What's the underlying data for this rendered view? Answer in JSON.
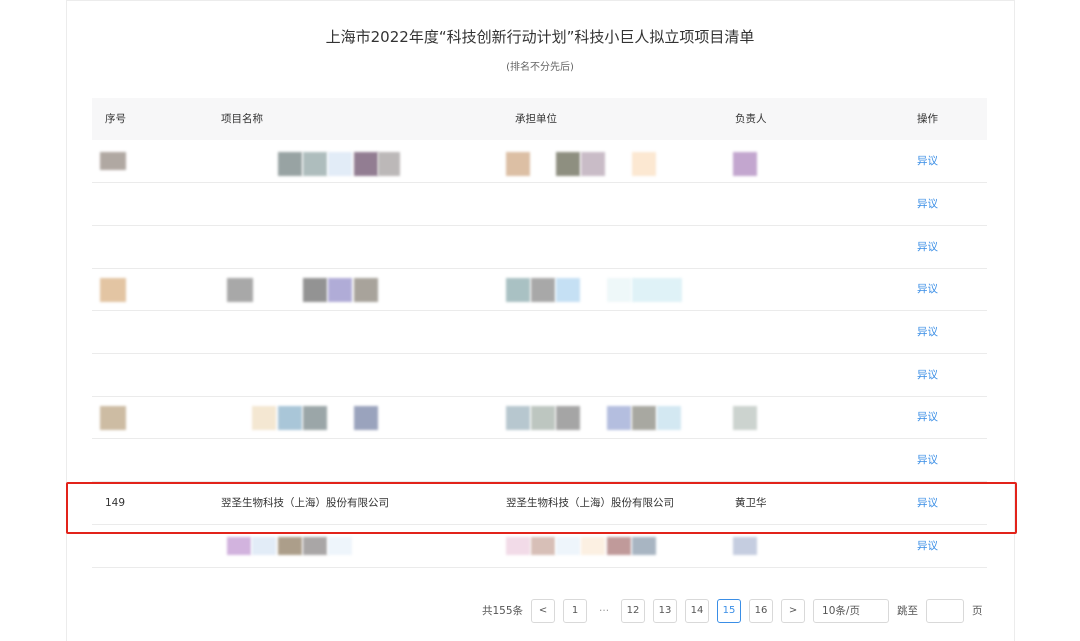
{
  "page": {
    "title": "上海市2022年度“科技创新行动计划”科技小巨人拟立项项目清单",
    "subtitle": "(排名不分先后)"
  },
  "table": {
    "headers": [
      "序号",
      "项目名称",
      "承担单位",
      "负责人",
      "操作"
    ],
    "action_label": "异议",
    "visible_row": {
      "index": "149",
      "project": "翌圣生物科技（上海）股份有限公司",
      "unit": "翌圣生物科技（上海）股份有限公司",
      "owner": "黄卫华"
    }
  },
  "pagination": {
    "total": "共155条",
    "prev": "<",
    "next": ">",
    "pages": [
      "1",
      "12",
      "13",
      "14",
      "15",
      "16"
    ],
    "ellipsis": "···",
    "page_size": "10条/页",
    "goto_label": "跳至",
    "goto_suffix": "页"
  }
}
